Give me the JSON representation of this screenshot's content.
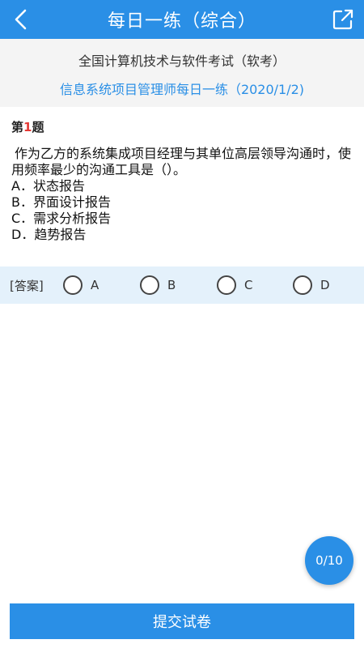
{
  "header": {
    "title": "每日一练（综合）",
    "back_icon": "chevron-left-icon",
    "share_icon": "share-external-icon"
  },
  "subheader": {
    "exam_name": "全国计算机技术与软件考试（软考）",
    "paper_name": "信息系统项目管理师每日一练（2020/1/2)"
  },
  "question": {
    "prefix": "第",
    "number": "1",
    "suffix": "题",
    "stem": "作为乙方的系统集成项目经理与其单位高层领导沟通时，使用频率最少的沟通工具是（）。",
    "options": [
      "A．状态报告",
      "B．界面设计报告",
      "C．需求分析报告",
      "D．趋势报告"
    ]
  },
  "answer": {
    "label": "[答案]",
    "choices": [
      "A",
      "B",
      "C",
      "D"
    ]
  },
  "progress": {
    "text": "0/10",
    "answered": 0,
    "total": 10
  },
  "footer": {
    "submit_label": "提交试卷"
  },
  "colors": {
    "primary": "#2a8fe6",
    "answer_bar": "#e4f1fb",
    "highlight": "#e53935"
  }
}
